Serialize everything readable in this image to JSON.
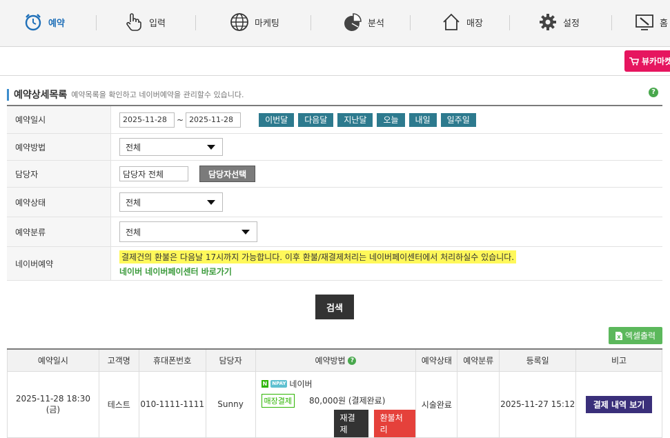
{
  "nav": {
    "items": [
      {
        "label": "예약",
        "icon": "alarm-clock-icon",
        "active": true
      },
      {
        "label": "입력",
        "icon": "pointer-hand-icon"
      },
      {
        "label": "마케팅",
        "icon": "globe-icon"
      },
      {
        "label": "분석",
        "icon": "pie-chart-icon"
      },
      {
        "label": "매장",
        "icon": "house-icon"
      },
      {
        "label": "설정",
        "icon": "gear-icon"
      },
      {
        "label": "홈",
        "icon": "monitor-tools-icon"
      }
    ]
  },
  "shop_button": "뷰카마켓",
  "section": {
    "title": "예약상세목록",
    "subtitle": "예약목록을 확인하고 네이버예약을 관리할수 있습니다.",
    "help": "?"
  },
  "filters": {
    "date": {
      "label": "예약일시",
      "from": "2025-11-28",
      "tilde": "~",
      "to": "2025-11-28",
      "quick": [
        "이번달",
        "다음달",
        "지난달",
        "오늘",
        "내일",
        "일주일"
      ]
    },
    "method": {
      "label": "예약방법",
      "value": "전체"
    },
    "staff": {
      "label": "담당자",
      "value": "담당자 전체",
      "button": "담당자선택"
    },
    "status": {
      "label": "예약상태",
      "value": "전체"
    },
    "category": {
      "label": "예약분류",
      "value": "전체"
    },
    "naver": {
      "label": "네이버예약",
      "notice": "결제건의 환불은 다음날 17시까지 가능합니다. 이후 환불/재결제처리는 네이버페이센터에서 처리하실수 있습니다.",
      "link": "네이버 네이버페이센터 바로가기"
    }
  },
  "search_button": "검색",
  "excel_button": "엑셀출력",
  "table": {
    "headers": [
      "예약일시",
      "고객명",
      "휴대폰번호",
      "담당자",
      "예약방법",
      "예약상태",
      "예약분류",
      "등록일",
      "비고"
    ],
    "rows": [
      {
        "datetime": "2025-11-28 18:30 (금)",
        "customer": "테스트",
        "phone": "010-1111-1111",
        "staff": "Sunny",
        "method_badge_n": "N",
        "method_badge_pay": "NPAY",
        "method_source": "네이버",
        "store_pay": "매장결제",
        "amount": "80,000원 (결제완료)",
        "repay": "재결제",
        "refund": "환불처리",
        "status": "시술완료",
        "category": "",
        "registered": "2025-11-27 15:12",
        "action": "결제 내역 보기"
      }
    ]
  },
  "colors": {
    "accent": "#1e6fb8",
    "quick_button": "#2d7a8e",
    "shop": "#e6155f",
    "naver_green": "#2db400",
    "excel": "#5cb85c",
    "refund": "#e5413b",
    "pay_view": "#3a2f7a"
  }
}
